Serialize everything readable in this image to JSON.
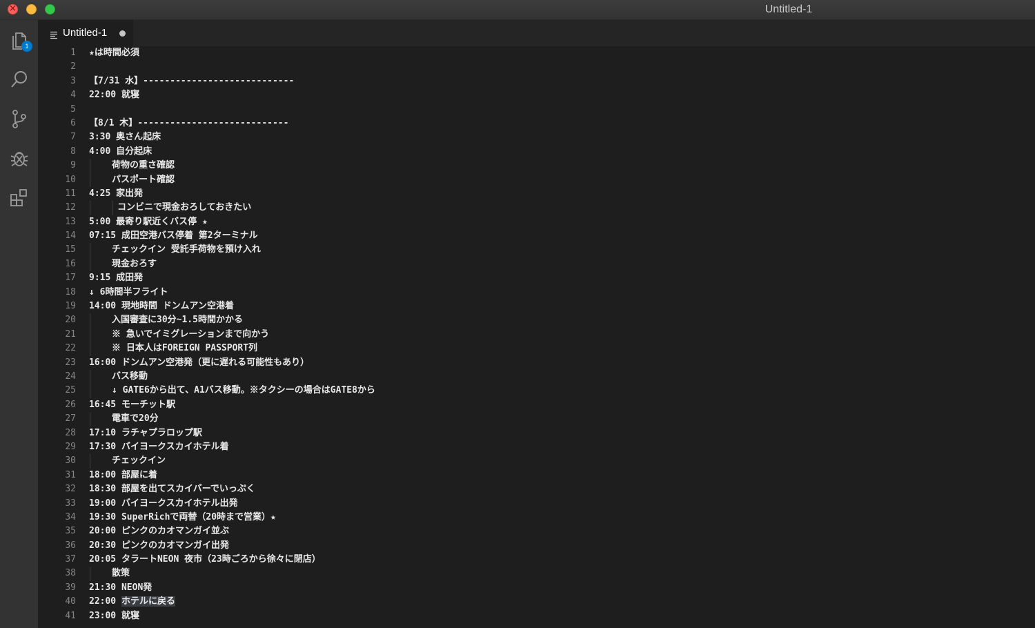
{
  "window": {
    "title": "Untitled-1"
  },
  "activity_bar": {
    "items": [
      {
        "icon": "files-icon",
        "badge": "1"
      },
      {
        "icon": "search-icon"
      },
      {
        "icon": "source-control-icon"
      },
      {
        "icon": "debug-icon"
      },
      {
        "icon": "extensions-icon"
      }
    ]
  },
  "tab": {
    "label": "Untitled-1",
    "dirty": true
  },
  "editor": {
    "highlighted_text": "ホテルに戻る",
    "lines": [
      {
        "n": "1",
        "text": "★は時間必須",
        "indent": 0
      },
      {
        "n": "2",
        "text": "",
        "indent": 0
      },
      {
        "n": "3",
        "text": "【7/31 水】----------------------------",
        "indent": 0
      },
      {
        "n": "4",
        "text": "22:00 就寝",
        "indent": 0
      },
      {
        "n": "5",
        "text": "",
        "indent": 0
      },
      {
        "n": "6",
        "text": "【8/1 木】----------------------------",
        "indent": 0
      },
      {
        "n": "7",
        "text": "3:30 奥さん起床",
        "indent": 0
      },
      {
        "n": "8",
        "text": "4:00 自分起床",
        "indent": 0
      },
      {
        "n": "9",
        "text": "荷物の重さ確認",
        "indent": 1
      },
      {
        "n": "10",
        "text": "パスポート確認",
        "indent": 1
      },
      {
        "n": "11",
        "text": "4:25 家出発",
        "indent": 0
      },
      {
        "n": "12",
        "text": "コンビニで現金おろしておきたい",
        "indent": 2
      },
      {
        "n": "13",
        "text": "5:00 最寄り駅近くバス停 ★",
        "indent": 0
      },
      {
        "n": "14",
        "text": "07:15 成田空港バス停着 第2ターミナル",
        "indent": 0
      },
      {
        "n": "15",
        "text": "チェックイン 受託手荷物を預け入れ",
        "indent": 1
      },
      {
        "n": "16",
        "text": "現金おろす",
        "indent": 1
      },
      {
        "n": "17",
        "text": "9:15 成田発",
        "indent": 0
      },
      {
        "n": "18",
        "text": "↓ 6時間半フライト",
        "indent": 0
      },
      {
        "n": "19",
        "text": "14:00 現地時間 ドンムアン空港着",
        "indent": 0
      },
      {
        "n": "20",
        "text": "入国審査に30分~1.5時間かかる",
        "indent": 1
      },
      {
        "n": "21",
        "text": "※ 急いでイミグレーションまで向かう",
        "indent": 1
      },
      {
        "n": "22",
        "text": "※ 日本人はFOREIGN PASSPORT列",
        "indent": 1
      },
      {
        "n": "23",
        "text": "16:00 ドンムアン空港発（更に遅れる可能性もあり）",
        "indent": 0
      },
      {
        "n": "24",
        "text": "バス移動",
        "indent": 1
      },
      {
        "n": "25",
        "text": "↓ GATE6から出て、A1バス移動。※タクシーの場合はGATE8から",
        "indent": 1
      },
      {
        "n": "26",
        "text": "16:45 モーチット駅",
        "indent": 0
      },
      {
        "n": "27",
        "text": "電車で20分",
        "indent": 1
      },
      {
        "n": "28",
        "text": "17:10 ラチャプラロップ駅",
        "indent": 0
      },
      {
        "n": "29",
        "text": "17:30 バイヨークスカイホテル着",
        "indent": 0
      },
      {
        "n": "30",
        "text": "チェックイン",
        "indent": 1
      },
      {
        "n": "31",
        "text": "18:00 部屋に着",
        "indent": 0
      },
      {
        "n": "32",
        "text": "18:30 部屋を出てスカイバーでいっぷく",
        "indent": 0
      },
      {
        "n": "33",
        "text": "19:00 バイヨークスカイホテル出発",
        "indent": 0
      },
      {
        "n": "34",
        "text": "19:30 SuperRichで両替（20時まで営業）★",
        "indent": 0
      },
      {
        "n": "35",
        "text": "20:00 ピンクのカオマンガイ並ぶ",
        "indent": 0
      },
      {
        "n": "36",
        "text": "20:30 ピンクのカオマンガイ出発",
        "indent": 0
      },
      {
        "n": "37",
        "text": "20:05 タラートNEON 夜市（23時ごろから徐々に閉店）",
        "indent": 0
      },
      {
        "n": "38",
        "text": "散策",
        "indent": 1
      },
      {
        "n": "39",
        "text": "21:30 NEON発",
        "indent": 0
      },
      {
        "n": "40",
        "text": "22:00 ",
        "indent": 0,
        "hl": "ホテルに戻る"
      },
      {
        "n": "41",
        "text": "23:00 就寝",
        "indent": 0
      }
    ]
  }
}
